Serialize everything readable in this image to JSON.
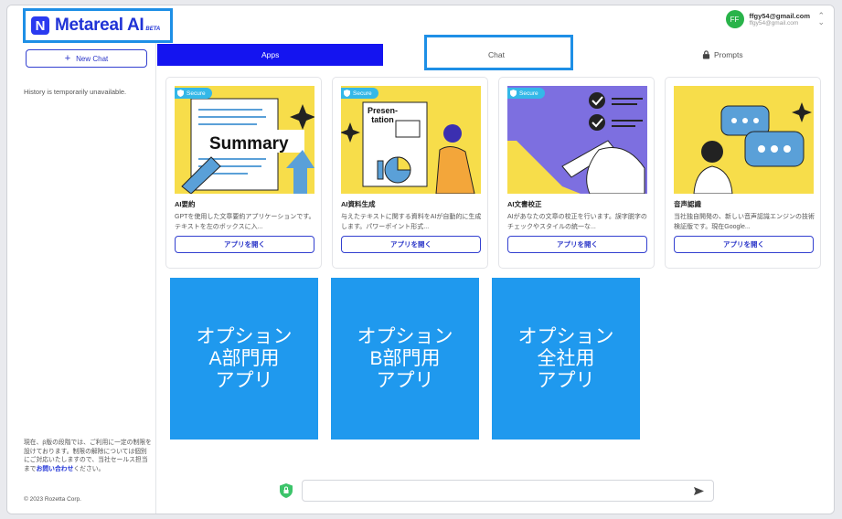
{
  "header": {
    "logo_mark": "N",
    "logo_text": "Metareal AI",
    "logo_beta": "BETA",
    "user_initials": "FF",
    "user_name": "ffgy54@gmail.com",
    "user_email": "ffgy54@gmail.com"
  },
  "sidebar": {
    "new_chat_label": "New Chat",
    "history_text": "History is temporarily unavailable.",
    "note_text": "現在、β版の段階では、ご利用に一定の制限を設けております。制限の解除については個別にご対応いたしますので、当社セールス担当まで",
    "note_link": "お問い合わせ",
    "note_tail": "ください。",
    "copyright": "© 2023 Rozetta Corp."
  },
  "tabs": [
    {
      "label": "Apps",
      "active": true
    },
    {
      "label": "Chat",
      "active": false
    },
    {
      "label": "Prompts",
      "active": false
    }
  ],
  "cards": [
    {
      "secure": "Secure",
      "image_text": "Summary",
      "title": "AI要約",
      "desc": "GPTを使用した文章要約アプリケーションです。テキストを左のボックスに入...",
      "button": "アプリを開く"
    },
    {
      "secure": "Secure",
      "image_text": "Presen-\ntation",
      "title": "AI資料生成",
      "desc": "与えたテキストに関する資料をAIが自動的に生成します。パワーポイント形式...",
      "button": "アプリを開く"
    },
    {
      "secure": "Secure",
      "image_text": "",
      "title": "AI文書校正",
      "desc": "AIがあなたの文章の校正を行います。誤字脱字のチェックやスタイルの統一な...",
      "button": "アプリを開く"
    },
    {
      "secure": "",
      "image_text": "",
      "title": "音声認識",
      "desc": "当社独自開発の、新しい音声認識エンジンの技術検証版です。現在Google...",
      "button": "アプリを開く"
    }
  ],
  "options": [
    "オプション\nA部門用\nアプリ",
    "オプション\nB部門用\nアプリ",
    "オプション\n全社用\nアプリ"
  ],
  "chat_input": {
    "placeholder": ""
  },
  "colors": {
    "accent": "#1414f0",
    "annotation": "#1e8fe6",
    "option_tile": "#1f99ee",
    "secure": "#34b8e8",
    "card_image_bg": "#f7dd4a"
  }
}
